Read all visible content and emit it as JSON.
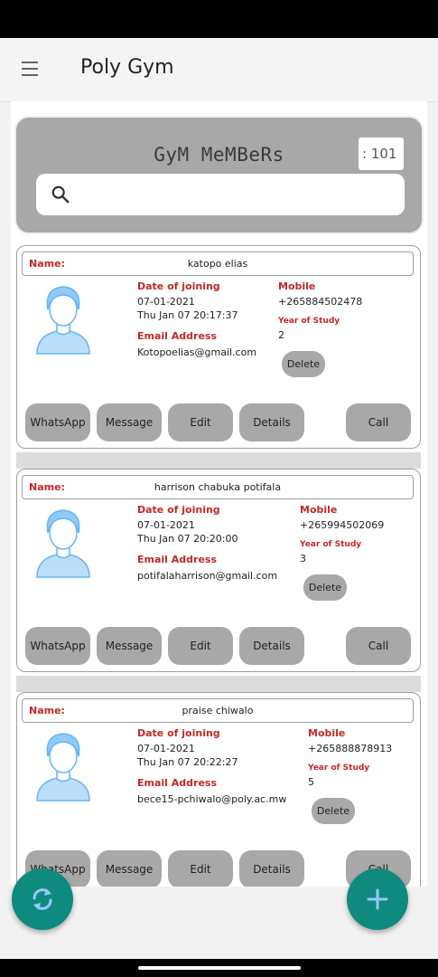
{
  "app": {
    "title": "Poly Gym"
  },
  "header": {
    "title": "GyM MeMBeRs",
    "count": ": 101"
  },
  "search": {
    "placeholder": ""
  },
  "labels": {
    "name": "Name:",
    "date_of_joining": "Date of joining",
    "mobile": "Mobile",
    "email": "Email Address",
    "year_of_study": "Year of Study",
    "delete": "Delete",
    "whatsapp": "WhatsApp",
    "message": "Message",
    "edit": "Edit",
    "details": "Details",
    "call": "Call"
  },
  "members": [
    {
      "name": "katopo elias",
      "date": "07-01-2021",
      "datetime": "Thu Jan 07 20:17:37",
      "mobile": "+265884502478",
      "year": "2",
      "email": "Kotopoelias@gmail.com"
    },
    {
      "name": "harrison chabuka potifala",
      "date": "07-01-2021",
      "datetime": "Thu Jan 07 20:20:00",
      "mobile": "+265994502069",
      "year": "3",
      "email": "potifalaharrison@gmail.com"
    },
    {
      "name": "praise chiwalo",
      "date": "07-01-2021",
      "datetime": "Thu Jan 07 20:22:27",
      "mobile": "+265888878913",
      "year": "5",
      "email": "bece15-pchiwalo@poly.ac.mw"
    }
  ]
}
